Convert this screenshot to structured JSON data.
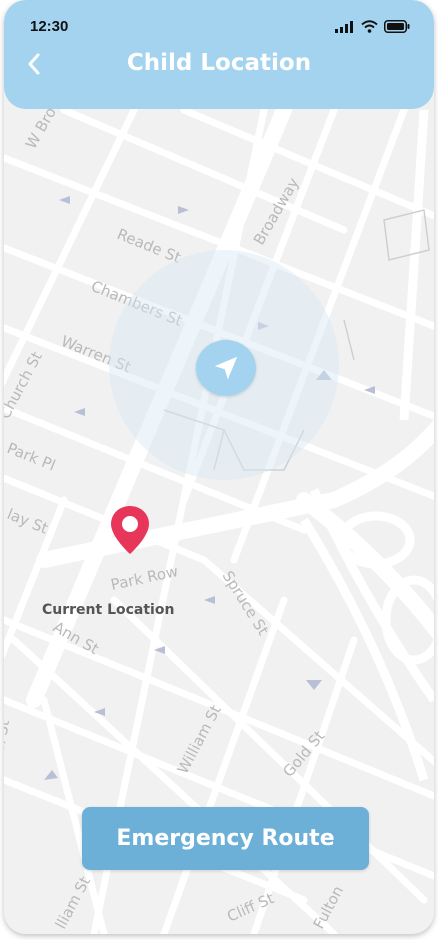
{
  "status_bar": {
    "time": "12:30"
  },
  "header": {
    "title": "Child Location"
  },
  "map": {
    "streets": [
      "W Bro",
      "Reade St",
      "Broadway",
      "Chambers St",
      "Warren St",
      "Church St",
      "Park Pl",
      "lay St",
      "Park Row",
      "Spruce St",
      "Ann St",
      "William St",
      "Gold St",
      "Cliff St",
      "Fulton",
      "lliam St",
      "n St"
    ],
    "current_location_label": "Current Location"
  },
  "actions": {
    "emergency_route_label": "Emergency Route"
  },
  "colors": {
    "header": "#a3d3ef",
    "button": "#6cb0d8",
    "pin": "#e8365a"
  }
}
